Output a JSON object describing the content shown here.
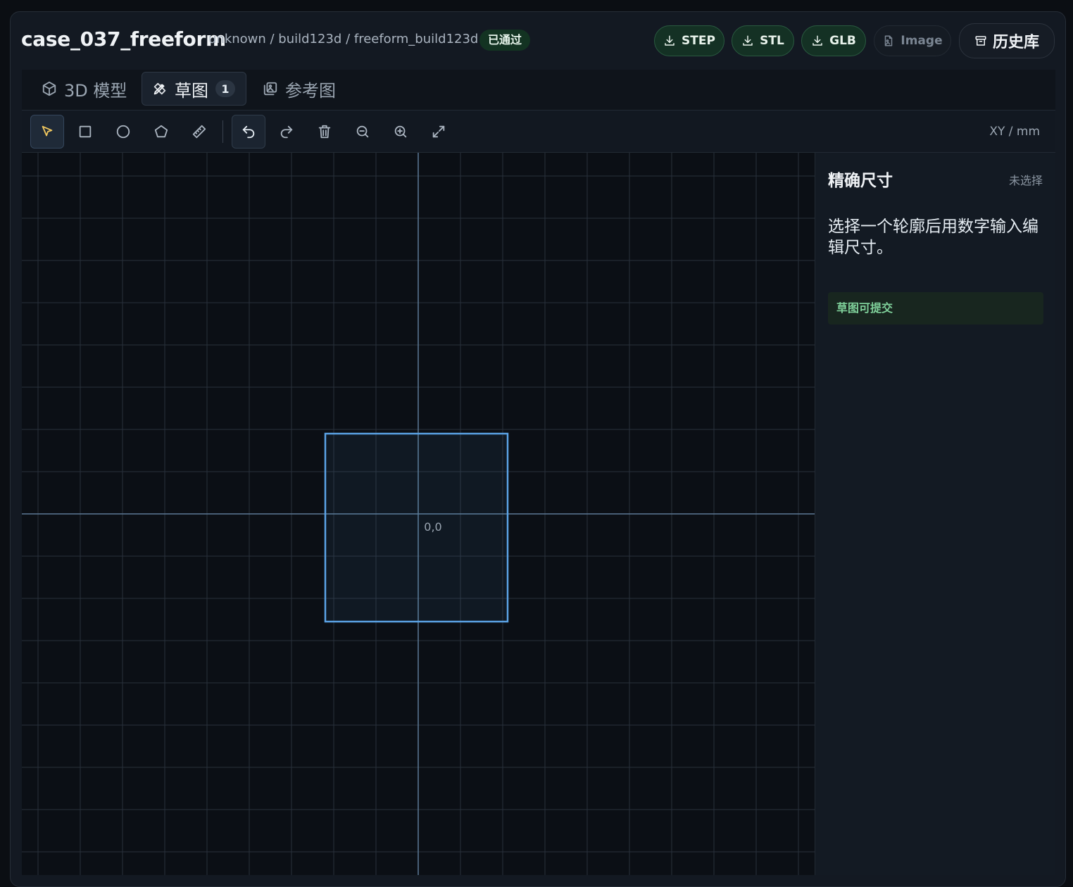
{
  "header": {
    "title": "case_037_freeform",
    "breadcrumb": "unknown / build123d / freeform_build123d",
    "status": "已通过",
    "buttons": {
      "step": "STEP",
      "stl": "STL",
      "glb": "GLB",
      "image": "Image",
      "history": "历史库"
    }
  },
  "tabs": [
    {
      "label": "3D 模型",
      "icon": "cube-icon"
    },
    {
      "label": "草图",
      "icon": "pencil-ruler-icon",
      "count": "1",
      "active": true
    },
    {
      "label": "参考图",
      "icon": "images-icon"
    }
  ],
  "toolbar": {
    "tools": [
      "select",
      "rectangle",
      "circle",
      "polygon",
      "measure",
      "undo",
      "redo",
      "delete",
      "zoom-out",
      "zoom-in",
      "fit-view"
    ],
    "active_tool": "select",
    "units": "XY / mm"
  },
  "canvas": {
    "origin_label": "0,0",
    "shape": "rectangle",
    "shape_color": "#5ba3e6"
  },
  "panel": {
    "title": "精确尺寸",
    "selection_status": "未选择",
    "hint": "选择一个轮廓后用数字输入编辑尺寸。",
    "ready_message": "草图可提交"
  },
  "colors": {
    "accent_blue": "#5ba3e6",
    "success_green": "#7fd09a",
    "cursor_yellow": "#f0c75e"
  }
}
